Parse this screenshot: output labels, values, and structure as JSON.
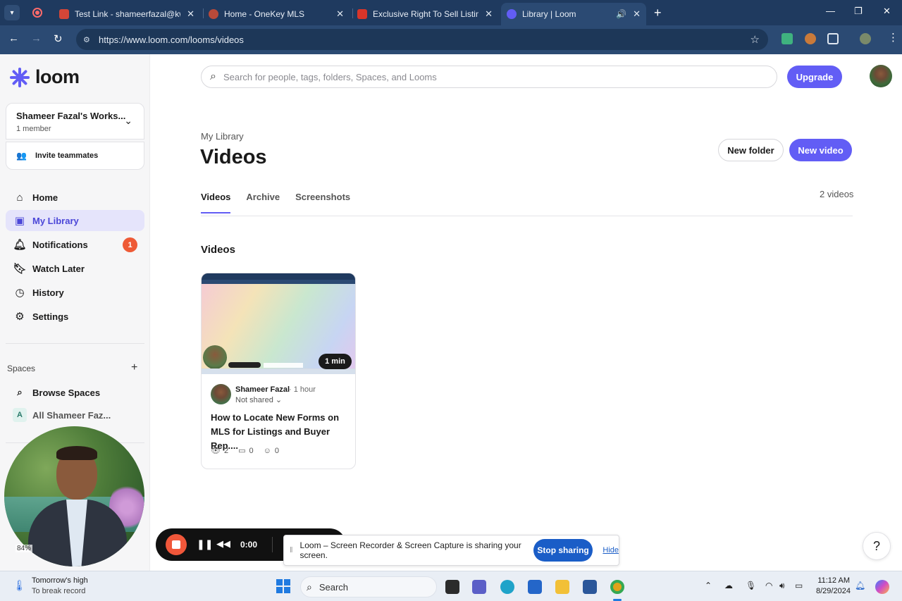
{
  "browser": {
    "tabs": [
      {
        "title": "Test Link - shameerfazal@kw.co",
        "favicon_color": "#d44638"
      },
      {
        "title": "Home - OneKey MLS",
        "favicon_color": "#b94a3a"
      },
      {
        "title": "Exclusive Right To Sell Listing A",
        "favicon_color": "#d8352a"
      },
      {
        "title": "Library | Loom",
        "favicon_color": "#625df5"
      }
    ],
    "url": "https://www.loom.com/looms/videos"
  },
  "sidebar": {
    "brand": "loom",
    "workspace_name": "Shameer Fazal's Works...",
    "workspace_members": "1 member",
    "invite_label": "Invite teammates",
    "nav": [
      {
        "label": "Home",
        "icon": "home-icon"
      },
      {
        "label": "My Library",
        "icon": "library-icon"
      },
      {
        "label": "Notifications",
        "icon": "bell-icon",
        "badge": "1"
      },
      {
        "label": "Watch Later",
        "icon": "bookmark-icon"
      },
      {
        "label": "History",
        "icon": "clock-icon"
      },
      {
        "label": "Settings",
        "icon": "gear-icon"
      }
    ],
    "spaces_header": "Spaces",
    "spaces": [
      {
        "label": "Browse Spaces",
        "icon": "search-icon"
      },
      {
        "label": "All Shameer Faz...",
        "avatar": "A"
      }
    ],
    "camera_zoom": "84%"
  },
  "header": {
    "search_placeholder": "Search for people, tags, folders, Spaces, and Looms",
    "upgrade_label": "Upgrade"
  },
  "page": {
    "breadcrumb": "My Library",
    "title": "Videos",
    "new_folder_label": "New folder",
    "new_video_label": "New video",
    "tabs": [
      "Videos",
      "Archive",
      "Screenshots"
    ],
    "count": "2 videos",
    "section_title": "Videos"
  },
  "video": {
    "duration": "1 min",
    "author": "Shameer Fazal",
    "age": "1 hour",
    "sharing": "Not shared",
    "title": "How to Locate New Forms on MLS for Listings and Buyer Rep....",
    "views": "2",
    "comments": "0",
    "reactions": "0"
  },
  "recorder": {
    "time": "0:00",
    "share_message": "Loom – Screen Recorder & Screen Capture is sharing your screen.",
    "stop_sharing_label": "Stop sharing",
    "hide_label": "Hide"
  },
  "help_label": "?",
  "taskbar": {
    "weather_line1": "Tomorrow's high",
    "weather_line2": "To break record",
    "search_label": "Search",
    "time": "11:12 AM",
    "date": "8/29/2024"
  }
}
